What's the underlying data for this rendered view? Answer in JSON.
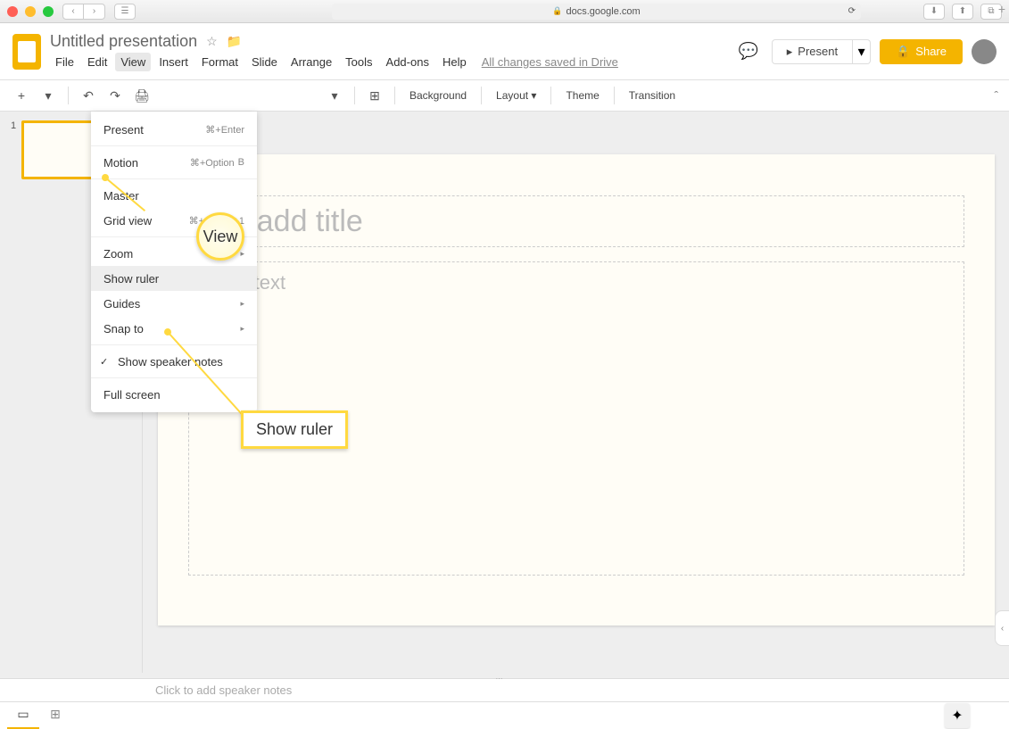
{
  "browser": {
    "url": "docs.google.com"
  },
  "document": {
    "title": "Untitled presentation",
    "save_status": "All changes saved in Drive"
  },
  "menubar": {
    "items": [
      "File",
      "Edit",
      "View",
      "Insert",
      "Format",
      "Slide",
      "Arrange",
      "Tools",
      "Add-ons",
      "Help"
    ]
  },
  "header_buttons": {
    "present": "Present",
    "share": "Share"
  },
  "toolbar": {
    "background": "Background",
    "layout": "Layout",
    "theme": "Theme",
    "transition": "Transition"
  },
  "slide_panel": {
    "slide_number": "1"
  },
  "canvas": {
    "title_placeholder": "k to add title",
    "body_placeholder": "o add text"
  },
  "dropdown": {
    "present": {
      "label": "Present",
      "shortcut": "⌘+Enter"
    },
    "motion": {
      "label": "Motion",
      "shortcut": "⌘+Option"
    },
    "motion_extra": "B",
    "master": "Master",
    "grid_view": {
      "label": "Grid view",
      "shortcut": "⌘+Option+1"
    },
    "zoom": "Zoom",
    "show_ruler": "Show ruler",
    "guides": "Guides",
    "snap_to": "Snap to",
    "show_speaker_notes": "Show speaker notes",
    "full_screen": "Full screen"
  },
  "callouts": {
    "view": "View",
    "show_ruler": "Show ruler"
  },
  "speaker_notes": {
    "placeholder": "Click to add speaker notes"
  }
}
